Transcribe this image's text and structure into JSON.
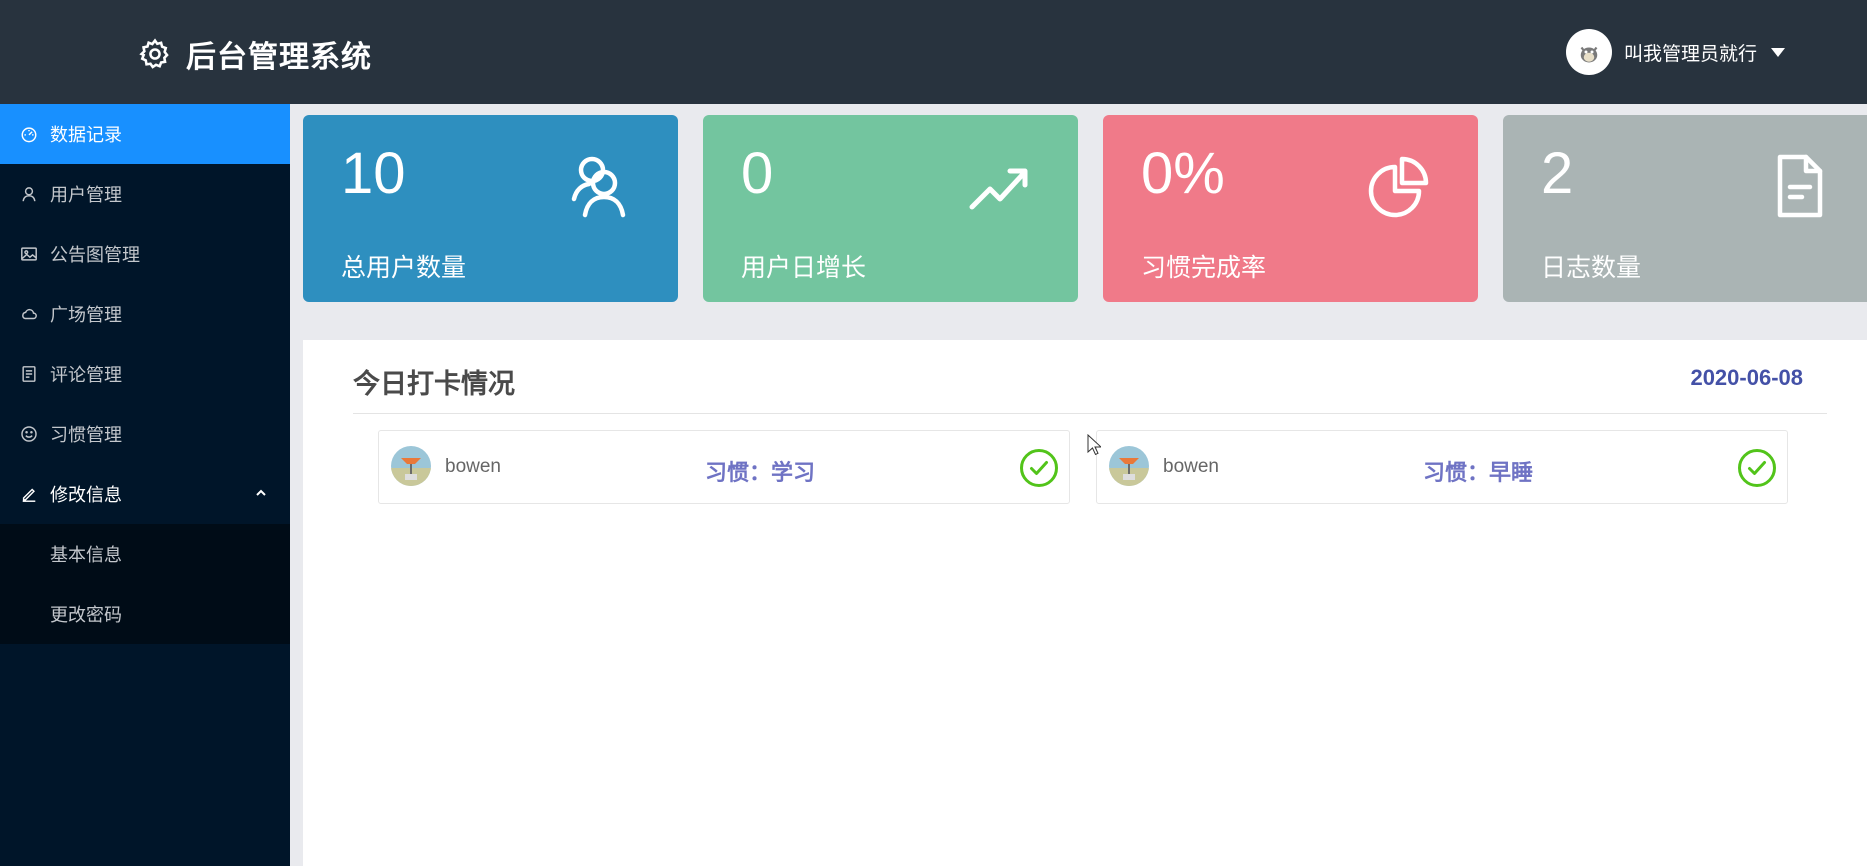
{
  "header": {
    "title": "后台管理系统",
    "username": "叫我管理员就行"
  },
  "sidebar": {
    "items": [
      {
        "label": "数据记录",
        "icon": "dashboard-icon"
      },
      {
        "label": "用户管理",
        "icon": "user-icon"
      },
      {
        "label": "公告图管理",
        "icon": "picture-icon"
      },
      {
        "label": "广场管理",
        "icon": "cloud-icon"
      },
      {
        "label": "评论管理",
        "icon": "comment-doc-icon"
      },
      {
        "label": "习惯管理",
        "icon": "smile-icon"
      },
      {
        "label": "修改信息",
        "icon": "edit-icon"
      }
    ],
    "submenu": [
      {
        "label": "基本信息"
      },
      {
        "label": "更改密码"
      }
    ]
  },
  "stats": [
    {
      "value": "10",
      "label": "总用户数量",
      "color": "#2e8fbf",
      "icon": "users-icon"
    },
    {
      "value": "0",
      "label": "用户日增长",
      "color": "#73c59f",
      "icon": "trend-up-icon"
    },
    {
      "value": "0%",
      "label": "习惯完成率",
      "color": "#f07a89",
      "icon": "pie-chart-icon"
    },
    {
      "value": "2",
      "label": "日志数量",
      "color": "#aab4b4",
      "icon": "document-icon"
    }
  ],
  "checkins": {
    "title": "今日打卡情况",
    "date": "2020-06-08",
    "items": [
      {
        "user": "bowen",
        "habit_label": "习惯",
        "sep": "：",
        "habit": "学习"
      },
      {
        "user": "bowen",
        "habit_label": "习惯",
        "sep": "：",
        "habit": "早睡"
      }
    ]
  },
  "colors": {
    "header_bg": "#28333e",
    "sidebar_bg": "#001529",
    "active": "#1890ff",
    "check_green": "#52c41a",
    "habit_text": "#6f73c4",
    "date_text": "#4451a7"
  }
}
